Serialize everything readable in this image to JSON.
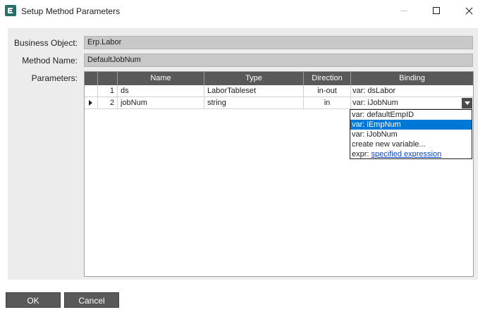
{
  "window": {
    "title": "Setup Method Parameters"
  },
  "fields": {
    "business_object_label": "Business Object:",
    "business_object_value": "Erp.Labor",
    "method_name_label": "Method Name:",
    "method_name_value": "DefaultJobNum",
    "parameters_label": "Parameters:"
  },
  "grid": {
    "columns": [
      "Name",
      "Type",
      "Direction",
      "Binding"
    ],
    "rows": [
      {
        "num": "1",
        "name": "ds",
        "type": "LaborTableset",
        "direction": "in-out",
        "binding": "var: dsLabor"
      },
      {
        "num": "2",
        "name": "jobNum",
        "type": "string",
        "direction": "in",
        "binding": "var: iJobNum"
      }
    ]
  },
  "binding_dropdown": {
    "options": [
      {
        "text": "var: defaultEmpID",
        "selected": false
      },
      {
        "text": "var: iEmpNum",
        "selected": true
      },
      {
        "text": "var: iJobNum",
        "selected": false
      },
      {
        "text": "create new variable...",
        "selected": false
      }
    ],
    "expr_prefix": "expr:",
    "expr_link": "specified expression"
  },
  "buttons": {
    "ok": "OK",
    "cancel": "Cancel"
  },
  "colors": {
    "header": "#595959",
    "selection": "#0078d7",
    "panel": "#ececec",
    "field": "#c8c8c8"
  }
}
